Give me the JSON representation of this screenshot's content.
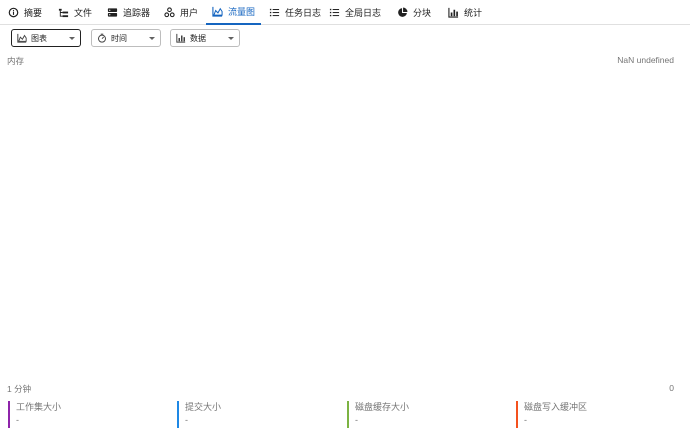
{
  "tabs": [
    {
      "label": "摘要",
      "icon": "info-icon"
    },
    {
      "label": "文件",
      "icon": "file-tree-icon"
    },
    {
      "label": "追踪器",
      "icon": "server-icon"
    },
    {
      "label": "用户",
      "icon": "peers-icon"
    },
    {
      "label": "流量图",
      "icon": "area-chart-icon",
      "active": true
    },
    {
      "label": "任务日志",
      "icon": "list-icon"
    },
    {
      "label": "全局日志",
      "icon": "list-icon"
    },
    {
      "label": "分块",
      "icon": "pie-icon"
    },
    {
      "label": "统计",
      "icon": "bar-chart-icon"
    }
  ],
  "toolbar": {
    "chart_select": "图表",
    "time_select": "时间",
    "data_select": "数据"
  },
  "chart": {
    "y_label": "内存",
    "y_value": "NaN undefined",
    "x_left": "1 分钟",
    "x_right": "0"
  },
  "legend": [
    {
      "name": "工作集大小",
      "value": "-",
      "color": "#8e24aa"
    },
    {
      "name": "提交大小",
      "value": "-",
      "color": "#1e88e5"
    },
    {
      "name": "磁盘缓存大小",
      "value": "-",
      "color": "#7cb342"
    },
    {
      "name": "磁盘写入缓冲区",
      "value": "-",
      "color": "#f4511e"
    }
  ]
}
